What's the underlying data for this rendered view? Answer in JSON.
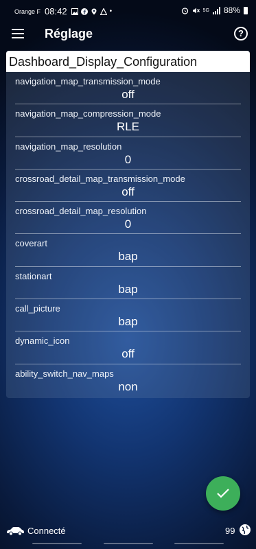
{
  "status_bar": {
    "carrier": "Orange F",
    "time": "08:42",
    "dot": "•",
    "network": "5G",
    "battery": "88%"
  },
  "app_bar": {
    "title": "Réglage",
    "help": "?"
  },
  "panel": {
    "title": "Dashboard_Display_Configuration",
    "rows": [
      {
        "label": "navigation_map_transmission_mode",
        "value": "off"
      },
      {
        "label": "navigation_map_compression_mode",
        "value": "RLE"
      },
      {
        "label": "navigation_map_resolution",
        "value": "0"
      },
      {
        "label": "crossroad_detail_map_transmission_mode",
        "value": "off"
      },
      {
        "label": "crossroad_detail_map_resolution",
        "value": "0"
      },
      {
        "label": "coverart",
        "value": "bap"
      },
      {
        "label": "stationart",
        "value": "bap"
      },
      {
        "label": "call_picture",
        "value": "bap"
      },
      {
        "label": "dynamic_icon",
        "value": "off"
      },
      {
        "label": "ability_switch_nav_maps",
        "value": "non"
      }
    ]
  },
  "fab": {
    "icon": "check-icon",
    "color": "#3daf5a"
  },
  "bottom_bar": {
    "connection_status": "Connecté",
    "count": "99"
  }
}
